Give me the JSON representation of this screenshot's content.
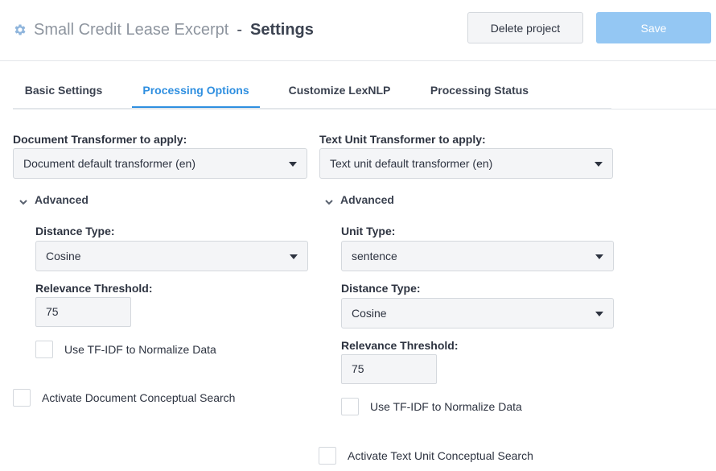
{
  "header": {
    "project_name": "Small Credit Lease Excerpt",
    "separator": "-",
    "page_title": "Settings",
    "delete_label": "Delete project",
    "save_label": "Save"
  },
  "tabs": [
    {
      "label": "Basic Settings",
      "active": false
    },
    {
      "label": "Processing Options",
      "active": true
    },
    {
      "label": "Customize LexNLP",
      "active": false
    },
    {
      "label": "Processing Status",
      "active": false
    }
  ],
  "document": {
    "transformer_label": "Document Transformer to apply:",
    "transformer_value": "Document default transformer (en)",
    "advanced_label": "Advanced",
    "distance_type_label": "Distance Type:",
    "distance_type_value": "Cosine",
    "relevance_label": "Relevance Threshold:",
    "relevance_value": "75",
    "tfidf_label": "Use TF-IDF to Normalize Data",
    "tfidf_checked": false,
    "conceptual_label": "Activate Document Conceptual Search",
    "conceptual_checked": false
  },
  "text_unit": {
    "transformer_label": "Text Unit Transformer to apply:",
    "transformer_value": "Text unit default transformer (en)",
    "advanced_label": "Advanced",
    "unit_type_label": "Unit Type:",
    "unit_type_value": "sentence",
    "distance_type_label": "Distance Type:",
    "distance_type_value": "Cosine",
    "relevance_label": "Relevance Threshold:",
    "relevance_value": "75",
    "tfidf_label": "Use TF-IDF to Normalize Data",
    "tfidf_checked": false,
    "conceptual_label": "Activate Text Unit Conceptual Search",
    "conceptual_checked": false
  },
  "colors": {
    "accent": "#2f8fe0",
    "save_button": "#94c7f3",
    "field_bg": "#f4f5f7"
  }
}
